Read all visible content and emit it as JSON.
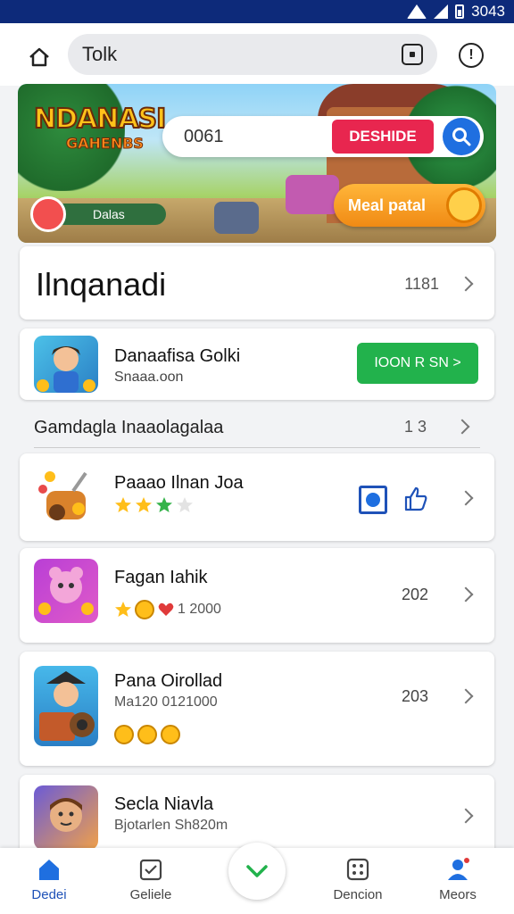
{
  "status_bar": {
    "time": "3043"
  },
  "top_bar": {
    "search_value": "Tolk"
  },
  "banner": {
    "logo_line1": "NDANASI",
    "logo_line2": "GAHENBS",
    "search_value": "0061",
    "search_button": "DESHIDE",
    "pill_label": "Dalas",
    "cta_label": "Meal patal"
  },
  "section": {
    "title": "Ilnqanadi",
    "count": "1181"
  },
  "featured": {
    "name": "Danaafisa Golki",
    "subtitle": "Snaaa.oon",
    "button": "IOON R SN >"
  },
  "subheader": {
    "label": "Gamdagla Inaaolagalaa",
    "count": "1 3"
  },
  "items": [
    {
      "name": "Paaao Ilnan Joa",
      "meta": "",
      "number": ""
    },
    {
      "name": "Fagan Iahik",
      "meta": "1 2000",
      "number": "202"
    },
    {
      "name": "Pana Oirollad",
      "meta": "Ma120 0121000",
      "number": "203"
    },
    {
      "name": "Secla Niavla",
      "meta": "Bjotarlen Sh820m",
      "number": ""
    }
  ],
  "bottom_nav": [
    {
      "label": "Dedei"
    },
    {
      "label": "Geliele"
    },
    {
      "label": "Dencion"
    },
    {
      "label": "Meors"
    }
  ],
  "colors": {
    "accent": "#1f6fe0",
    "green": "#22b24c",
    "status_bar": "#0d2a7a"
  }
}
